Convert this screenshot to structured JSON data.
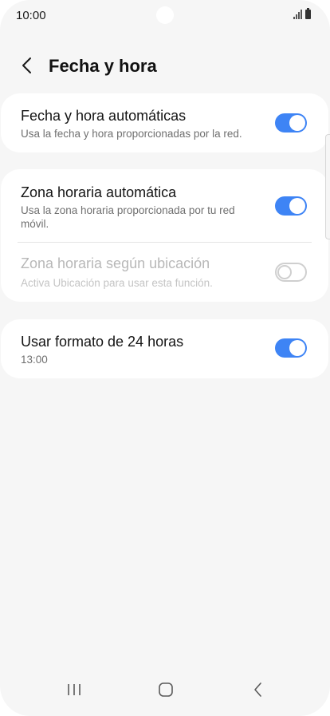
{
  "status_bar": {
    "time": "10:00"
  },
  "header": {
    "title": "Fecha y hora",
    "back_icon": "chevron-left-icon"
  },
  "settings": {
    "auto_datetime": {
      "title": "Fecha y hora automáticas",
      "subtitle": "Usa la fecha y hora proporcionadas por la red.",
      "enabled": true
    },
    "auto_timezone": {
      "title": "Zona horaria automática",
      "subtitle": "Usa la zona horaria proporcionada por tu red móvil.",
      "enabled": true
    },
    "location_timezone": {
      "title": "Zona horaria según ubicación",
      "subtitle": "Activa Ubicación para usar esta función.",
      "enabled": false,
      "disabled": true
    },
    "format_24h": {
      "title": "Usar formato de 24 horas",
      "subtitle": "13:00",
      "enabled": true
    }
  },
  "colors": {
    "accent": "#3e84f5",
    "background": "#f6f6f6",
    "card": "#ffffff"
  },
  "nav_bar": {
    "recents_icon": "recents-icon",
    "home_icon": "home-icon",
    "back_icon": "back-icon"
  }
}
